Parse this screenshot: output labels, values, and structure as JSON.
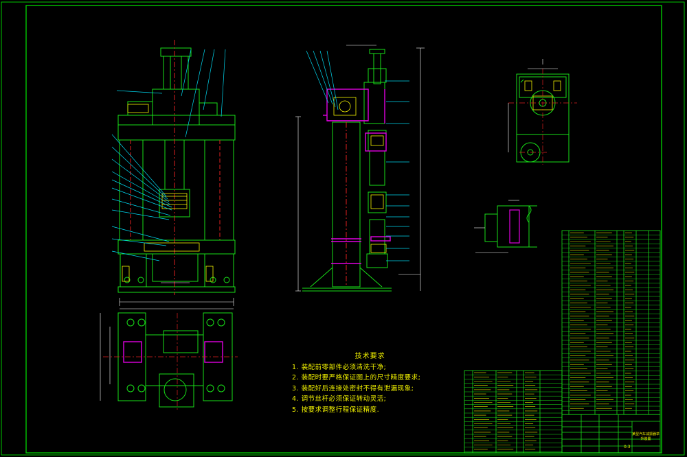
{
  "drawing": {
    "title": "某型汽车减振器举升装置",
    "sheet_no": "0.3"
  },
  "tech_notes": {
    "title": "技术要求",
    "items": [
      "1. 装配前零部件必须清洗干净;",
      "2. 装配时要严格保证图上的尺寸精度要求;",
      "3. 装配好后连接处密封不得有泄漏现象;",
      "4. 调节丝杆必须保证转动灵活;",
      "5. 按要求调整行程保证精度."
    ]
  },
  "colors": {
    "frame": "#00c800",
    "outline": "#18e018",
    "leader": "#00d8f0",
    "hidden": "#e000e0",
    "center": "#e02020",
    "text": "#f4f400",
    "dim": "#ffffff"
  }
}
